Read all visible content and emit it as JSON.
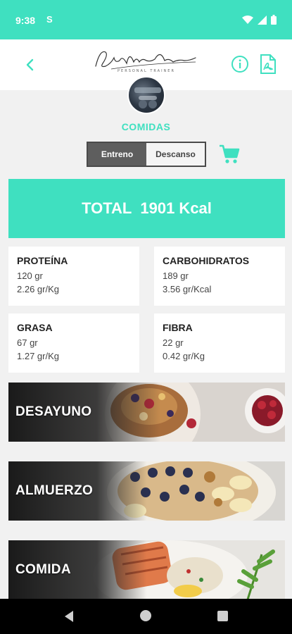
{
  "status_bar": {
    "time": "9:38",
    "s_icon_label": "S"
  },
  "header": {
    "logo_text": "Eva María Cerón",
    "logo_sub": "PERSONAL TRAINER"
  },
  "section_title": "COMIDAS",
  "toggle": {
    "option_1": "Entreno",
    "option_2": "Descanso",
    "selected": "Entreno"
  },
  "total": {
    "label": "TOTAL",
    "value": "1901 Kcal"
  },
  "macros": [
    {
      "title": "PROTEÍNA",
      "line1": "120 gr",
      "line2": "2.26 gr/Kg"
    },
    {
      "title": "CARBOHIDRATOS",
      "line1": "189 gr",
      "line2": "3.56 gr/Kcal"
    },
    {
      "title": "GRASA",
      "line1": "67 gr",
      "line2": "1.27 gr/Kg"
    },
    {
      "title": "FIBRA",
      "line1": "22 gr",
      "line2": "0.42 gr/Kg"
    }
  ],
  "meals": [
    {
      "label": "DESAYUNO"
    },
    {
      "label": "ALMUERZO"
    },
    {
      "label": "COMIDA"
    }
  ],
  "colors": {
    "accent": "#3fe0c0",
    "toggle_active": "#5e5e5e",
    "background": "#f1f1f1"
  }
}
